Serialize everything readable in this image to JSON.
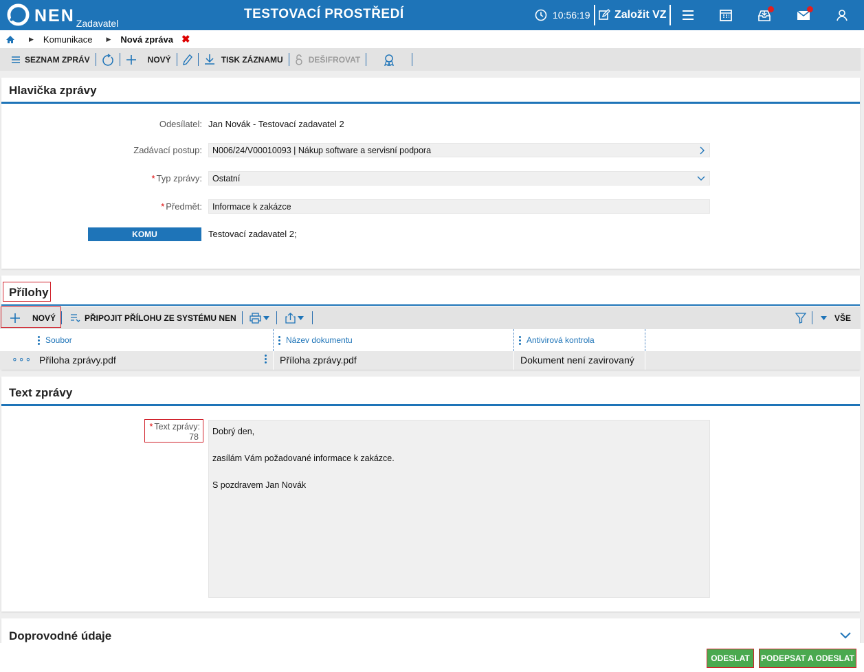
{
  "header": {
    "logo_text": "NEN",
    "role": "Zadavatel",
    "env_title": "TESTOVACÍ PROSTŘEDÍ",
    "time": "10:56:19",
    "create_label": "Založit VZ",
    "icons": [
      "clock-icon",
      "edit-icon",
      "menu-icon",
      "calendar-icon",
      "inbox-icon",
      "mail-icon",
      "user-icon"
    ],
    "accent_color": "#1e74b8",
    "notification_color": "#e02020"
  },
  "breadcrumb": {
    "items": [
      "Komunikace",
      "Nová zpráva"
    ]
  },
  "toolbar": {
    "list_label": "SEZNAM ZPRÁV",
    "new_label": "NOVÝ",
    "print_label": "TISK ZÁZNAMU",
    "decrypt_label": "DEŠIFROVAT"
  },
  "header_section": {
    "title": "Hlavička zprávy",
    "sender_label": "Odesílatel:",
    "sender_value": "Jan Novák - Testovací zadavatel 2",
    "procedure_label": "Zadávací postup:",
    "procedure_value": "N006/24/V00010093 | Nákup software a servisní podpora",
    "type_label": "Typ zprávy:",
    "type_value": "Ostatní",
    "subject_label": "Předmět:",
    "subject_value": "Informace k zakázce",
    "to_button": "KOMU",
    "to_value": "Testovací zadavatel 2;"
  },
  "attachments": {
    "title": "Přílohy",
    "new_label": "NOVÝ",
    "attach_label": "PŘIPOJIT PŘÍLOHU ZE SYSTÉMU NEN",
    "filter_all": "VŠE",
    "columns": [
      "Soubor",
      "Název dokumentu",
      "Antivirová kontrola"
    ],
    "rows": [
      {
        "file": "Příloha zprávy.pdf",
        "name": "Příloha zprávy.pdf",
        "antivirus": "Dokument není zavirovaný"
      }
    ]
  },
  "message": {
    "title": "Text zprávy",
    "label": "Text zprávy:",
    "char_count": "78",
    "lines": [
      "Dobrý den,",
      "zasílám Vám požadované informace k zakázce.",
      "S pozdravem Jan Novák"
    ]
  },
  "accompanying": {
    "title": "Doprovodné údaje"
  },
  "footer": {
    "send_label": "ODESLAT",
    "sign_send_label": "PODEPSAT A ODESLAT",
    "button_color": "#4aa94f"
  }
}
